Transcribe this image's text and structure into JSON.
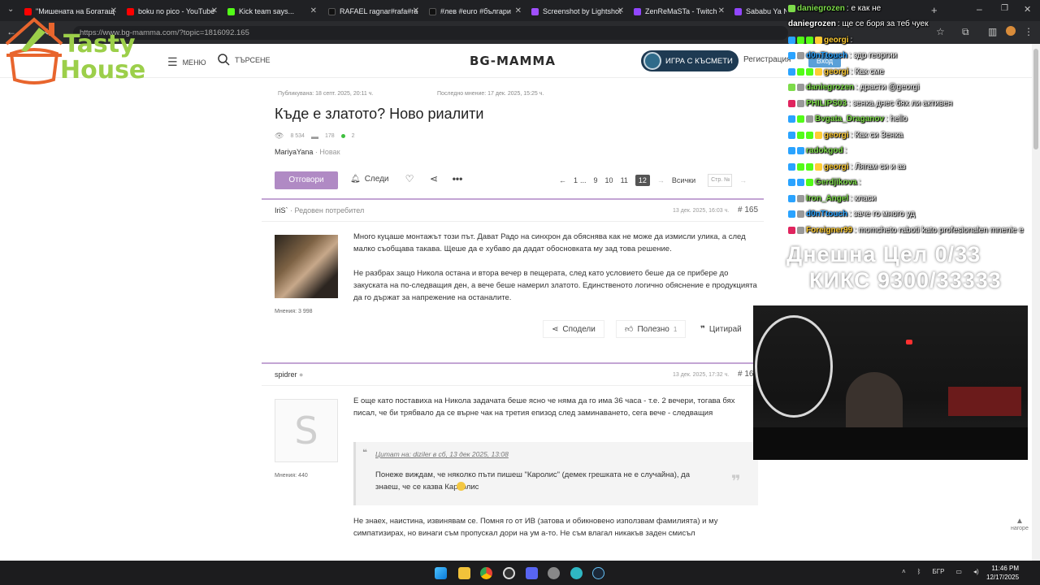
{
  "browser": {
    "tabs": [
      {
        "title": "\"Мишената на Богатащ",
        "favicon_color": "#ff0000"
      },
      {
        "title": "boku no pico - YouTube",
        "favicon_color": "#ff0000"
      },
      {
        "title": "Kick team says...",
        "favicon_color": "#53fc18"
      },
      {
        "title": "RAFAEL ragnar#rafa#ra",
        "favicon_color": "#111111"
      },
      {
        "title": "#лев #euro #българи",
        "favicon_color": "#111111"
      },
      {
        "title": "Screenshot by Lightshot",
        "favicon_color": "#a050ff"
      },
      {
        "title": "ZenReMaSTa - Twitch",
        "favicon_color": "#9146ff"
      },
      {
        "title": "Sababu Ya Nissan",
        "favicon_color": "#9146ff"
      }
    ],
    "url": "https://www.bg-mamma.com/?topic=1816092.165"
  },
  "site": {
    "menu_label": "МЕНЮ",
    "search_label": "ТЪРСЕНЕ",
    "logo": "BG-MAMMA",
    "game_button": "ИГРА С КЪСМЕТИ",
    "register_label": "Регистрация",
    "login_label": "Вход"
  },
  "overlay_logo": {
    "line1": "Tasty",
    "line2": "House"
  },
  "thread": {
    "published": "Публикувана: 18 септ. 2025, 20:11 ч.",
    "last_opinion": "Последно мнение: 17 дек. 2025, 15:25 ч.",
    "title": "Къде е златото? Ново риалити",
    "views": "8 534",
    "comments": "178",
    "online": "2",
    "author": "MariyaYana",
    "author_rank": "· Новак",
    "reply_label": "Отговори",
    "follow_label": "Следи",
    "pages": [
      "1",
      "...",
      "9",
      "10",
      "11",
      "12"
    ],
    "current_page": "12",
    "all_label": "Всички",
    "page_placeholder": "Стр. №"
  },
  "posts": [
    {
      "author": "IriS`",
      "rank": "· Редовен потребител",
      "date": "13 дек. 2025, 16:03 ч.",
      "number": "# 165",
      "opinions": "Мнения: 3 998",
      "para1": "Много куцаше монтажът този път. Дават Радо на синхрон да обяснява как не може да измисли улика, а след малко съобщава такава. Щеше да е хубаво да дадат обосновката му зад това решение.",
      "para2": "Не разбрах защо Никола остана и втора вечер в пещерата, след като условието беше да се прибере до закуската на по-следващия ден, а вече беше намерил златото. Единственото логично обяснение е продукцията да го държат за напрежение на останалите.",
      "share_label": "Сподели",
      "useful_label": "Полезно",
      "useful_count": "1",
      "quote_label": "Цитирай"
    },
    {
      "author": "spidrer",
      "date": "13 дек. 2025, 17:32 ч.",
      "number": "# 16",
      "opinions": "Мнения: 440",
      "avatar_letter": "S",
      "para1": "Е още като поставиха на Никола задачата беше ясно че няма да го има 36 часа  - т.е. 2 вечери, тогава бях писал, че  би трябвало да се върне чак на третия епизод след заминаването, сега вече - следващия",
      "quote_source": "Цитат на: diziler в сб, 13 дек 2025, 13:08",
      "quote_text": "Понеже виждам, че няколко пъти пишеш \"Каролис\" (демек грешката не е случайна), да знаеш, че се казва Караолис",
      "para2": "Не знаех, наистина, извинявам се. Помня го от ИВ (затова и обикновено използвам фамилията) и му симпатизирах, но винаги съм  пропускал дори на ум а-то.  Не съм влагал никакъв заден смисъл"
    }
  ],
  "chat": [
    {
      "user": "daniegrozen",
      "color": "#7ddc4a",
      "msg": ": е как не",
      "badges": [
        "#7ddc4a"
      ]
    },
    {
      "user": "daniegrozen",
      "color": "#ffffff",
      "msg": ": ще се боря за теб чуек",
      "badges": []
    },
    {
      "user": "georgi",
      "color": "#ffcc33",
      "msg": ":",
      "badges": [
        "#2aa3ff",
        "#53fc18",
        "#53fc18",
        "#ffcc33"
      ]
    },
    {
      "user": "d0nTtouch",
      "color": "#2aa3ff",
      "msg": ": здр георгии",
      "badges": [
        "#2aa3ff",
        "#999999"
      ]
    },
    {
      "user": "georgi",
      "color": "#ffcc33",
      "msg": ": Как сме",
      "badges": [
        "#2aa3ff",
        "#53fc18",
        "#53fc18",
        "#ffcc33"
      ]
    },
    {
      "user": "daniegrozen",
      "color": "#7ddc4a",
      "msg": ": драсти @georgi",
      "badges": [
        "#7ddc4a",
        "#999999"
      ]
    },
    {
      "user": "PHILIPS03",
      "color": "#7ddc4a",
      "msg": ": зенка днес бях ли активен",
      "badges": [
        "#e0245e",
        "#999999"
      ]
    },
    {
      "user": "Bvgata_Draganov",
      "color": "#7ddc4a",
      "msg": ": hello",
      "badges": [
        "#2aa3ff",
        "#53fc18",
        "#999999"
      ]
    },
    {
      "user": "georgi",
      "color": "#ffcc33",
      "msg": ": Как си Зенка",
      "badges": [
        "#2aa3ff",
        "#53fc18",
        "#53fc18",
        "#ffcc33"
      ]
    },
    {
      "user": "radokgod",
      "color": "#7ddc4a",
      "msg": ":",
      "badges": [
        "#2aa3ff",
        "#2aa3ff"
      ]
    },
    {
      "user": "georgi",
      "color": "#ffcc33",
      "msg": ": Лягам си и аз",
      "badges": [
        "#2aa3ff",
        "#53fc18",
        "#53fc18",
        "#ffcc33"
      ]
    },
    {
      "user": "Gerdjikova",
      "color": "#7ddc4a",
      "msg": ":",
      "badges": [
        "#2aa3ff",
        "#2aa3ff",
        "#53fc18"
      ]
    },
    {
      "user": "Iron_Angel",
      "color": "#7ddc4a",
      "msg": ": класи",
      "badges": [
        "#2aa3ff",
        "#999999"
      ]
    },
    {
      "user": "d0nTtouch",
      "color": "#2aa3ff",
      "msg": ": заче го много уд",
      "badges": [
        "#2aa3ff",
        "#999999"
      ]
    },
    {
      "user": "Foreigner99",
      "color": "#ffcc33",
      "msg": ": momcheto raboti kato profesionalen mneniе e",
      "badges": [
        "#e0245e",
        "#999999"
      ]
    }
  ],
  "goal": {
    "line1": "Днешна Цел 0/33",
    "line2": "КИКС 9300/33333"
  },
  "scroll_up_label": "нагоре",
  "taskbar": {
    "icons": [
      "windows-icon",
      "explorer-icon",
      "chrome-icon",
      "obs-icon",
      "discord-icon",
      "settings-icon",
      "edge-icon",
      "steam-icon"
    ],
    "language": "БГР",
    "time": "11:46 PM",
    "date": "12/17/2025"
  }
}
